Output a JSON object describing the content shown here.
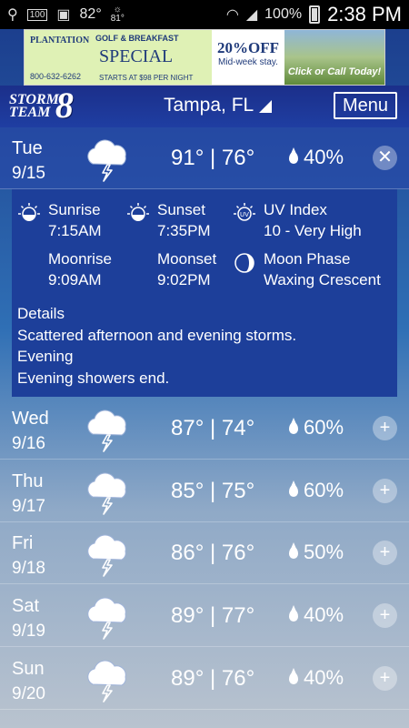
{
  "status_bar": {
    "battery_small": "100",
    "temp": "82°",
    "sun_temp": "81°",
    "battery_pct": "100%",
    "time": "2:38 PM"
  },
  "ad": {
    "brand": "PLANTATION",
    "phone": "800-632-6262",
    "headline_small": "GOLF & BREAKFAST",
    "headline": "SPECIAL",
    "starts": "STARTS AT $98 PER NIGHT",
    "discount": "20%OFF",
    "discount_sub": "Mid-week stay.",
    "cta": "Click or Call Today!"
  },
  "header": {
    "logo_text_1": "STORM",
    "logo_text_2": "TEAM",
    "logo_number": "8",
    "location": "Tampa, FL",
    "menu_label": "Menu"
  },
  "days": [
    {
      "name": "Tue",
      "date": "9/15",
      "high": "91°",
      "low": "76°",
      "precip": "40%",
      "button": "✕"
    },
    {
      "name": "Wed",
      "date": "9/16",
      "high": "87°",
      "low": "74°",
      "precip": "60%",
      "button": "+"
    },
    {
      "name": "Thu",
      "date": "9/17",
      "high": "85°",
      "low": "75°",
      "precip": "60%",
      "button": "+"
    },
    {
      "name": "Fri",
      "date": "9/18",
      "high": "86°",
      "low": "76°",
      "precip": "50%",
      "button": "+"
    },
    {
      "name": "Sat",
      "date": "9/19",
      "high": "89°",
      "low": "77°",
      "precip": "40%",
      "button": "+"
    },
    {
      "name": "Sun",
      "date": "9/20",
      "high": "89°",
      "low": "76°",
      "precip": "40%",
      "button": "+"
    }
  ],
  "detail": {
    "sunrise_label": "Sunrise",
    "sunrise": "7:15AM",
    "sunset_label": "Sunset",
    "sunset": "7:35PM",
    "uv_label": "UV Index",
    "uv": "10 - Very High",
    "moonrise_label": "Moonrise",
    "moonrise": "9:09AM",
    "moonset_label": "Moonset",
    "moonset": "9:02PM",
    "phase_label": "Moon Phase",
    "phase": "Waxing Crescent",
    "details_heading": "Details",
    "details_text": "Scattered afternoon and evening storms.",
    "evening_heading": "Evening",
    "evening_text": "Evening showers end."
  },
  "colors": {
    "header_bg": "#1f3ea2",
    "detail_bg": "#1d3f9a"
  }
}
